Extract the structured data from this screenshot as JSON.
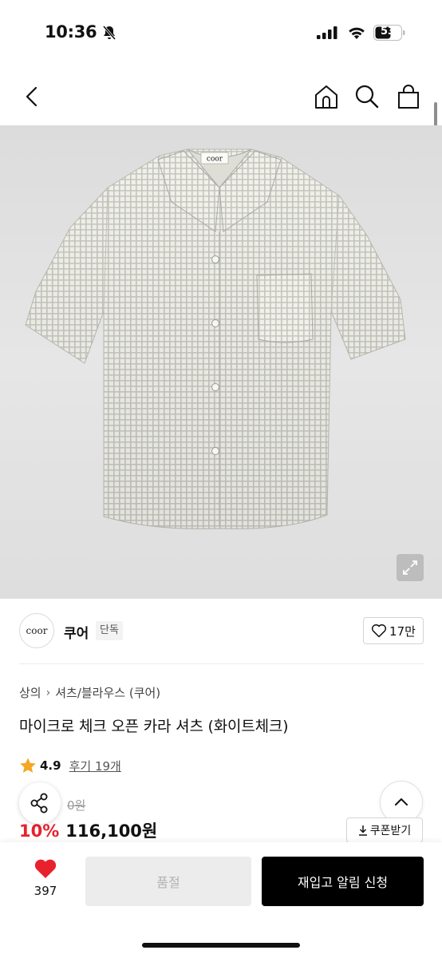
{
  "status_bar": {
    "time": "10:36",
    "battery": "53"
  },
  "brand": {
    "logo_text": "coor",
    "name": "쿠어",
    "badge": "단독",
    "likes": "17만"
  },
  "breadcrumb": {
    "category": "상의",
    "subcategory": "셔츠/블라우스 (쿠어)"
  },
  "product": {
    "title": "마이크로 체크 오픈 카라 셔츠 (화이트체크)",
    "rating": "4.9",
    "reviews": "후기 19개",
    "original_price": "0원",
    "discount": "10%",
    "price": "116,100원",
    "label_tag": "coor"
  },
  "actions": {
    "coupon": "쿠폰받기",
    "wish_count": "397",
    "soldout": "품절",
    "restock": "재입고 알림 신청"
  },
  "colors": {
    "accent_red": "#e8222d",
    "star": "#f5a623",
    "primary": "#000000"
  },
  "icons": [
    "back-icon",
    "home-icon",
    "search-icon",
    "bag-icon",
    "expand-icon",
    "heart-icon",
    "share-icon",
    "chevron-up-icon",
    "download-icon",
    "star-icon"
  ]
}
